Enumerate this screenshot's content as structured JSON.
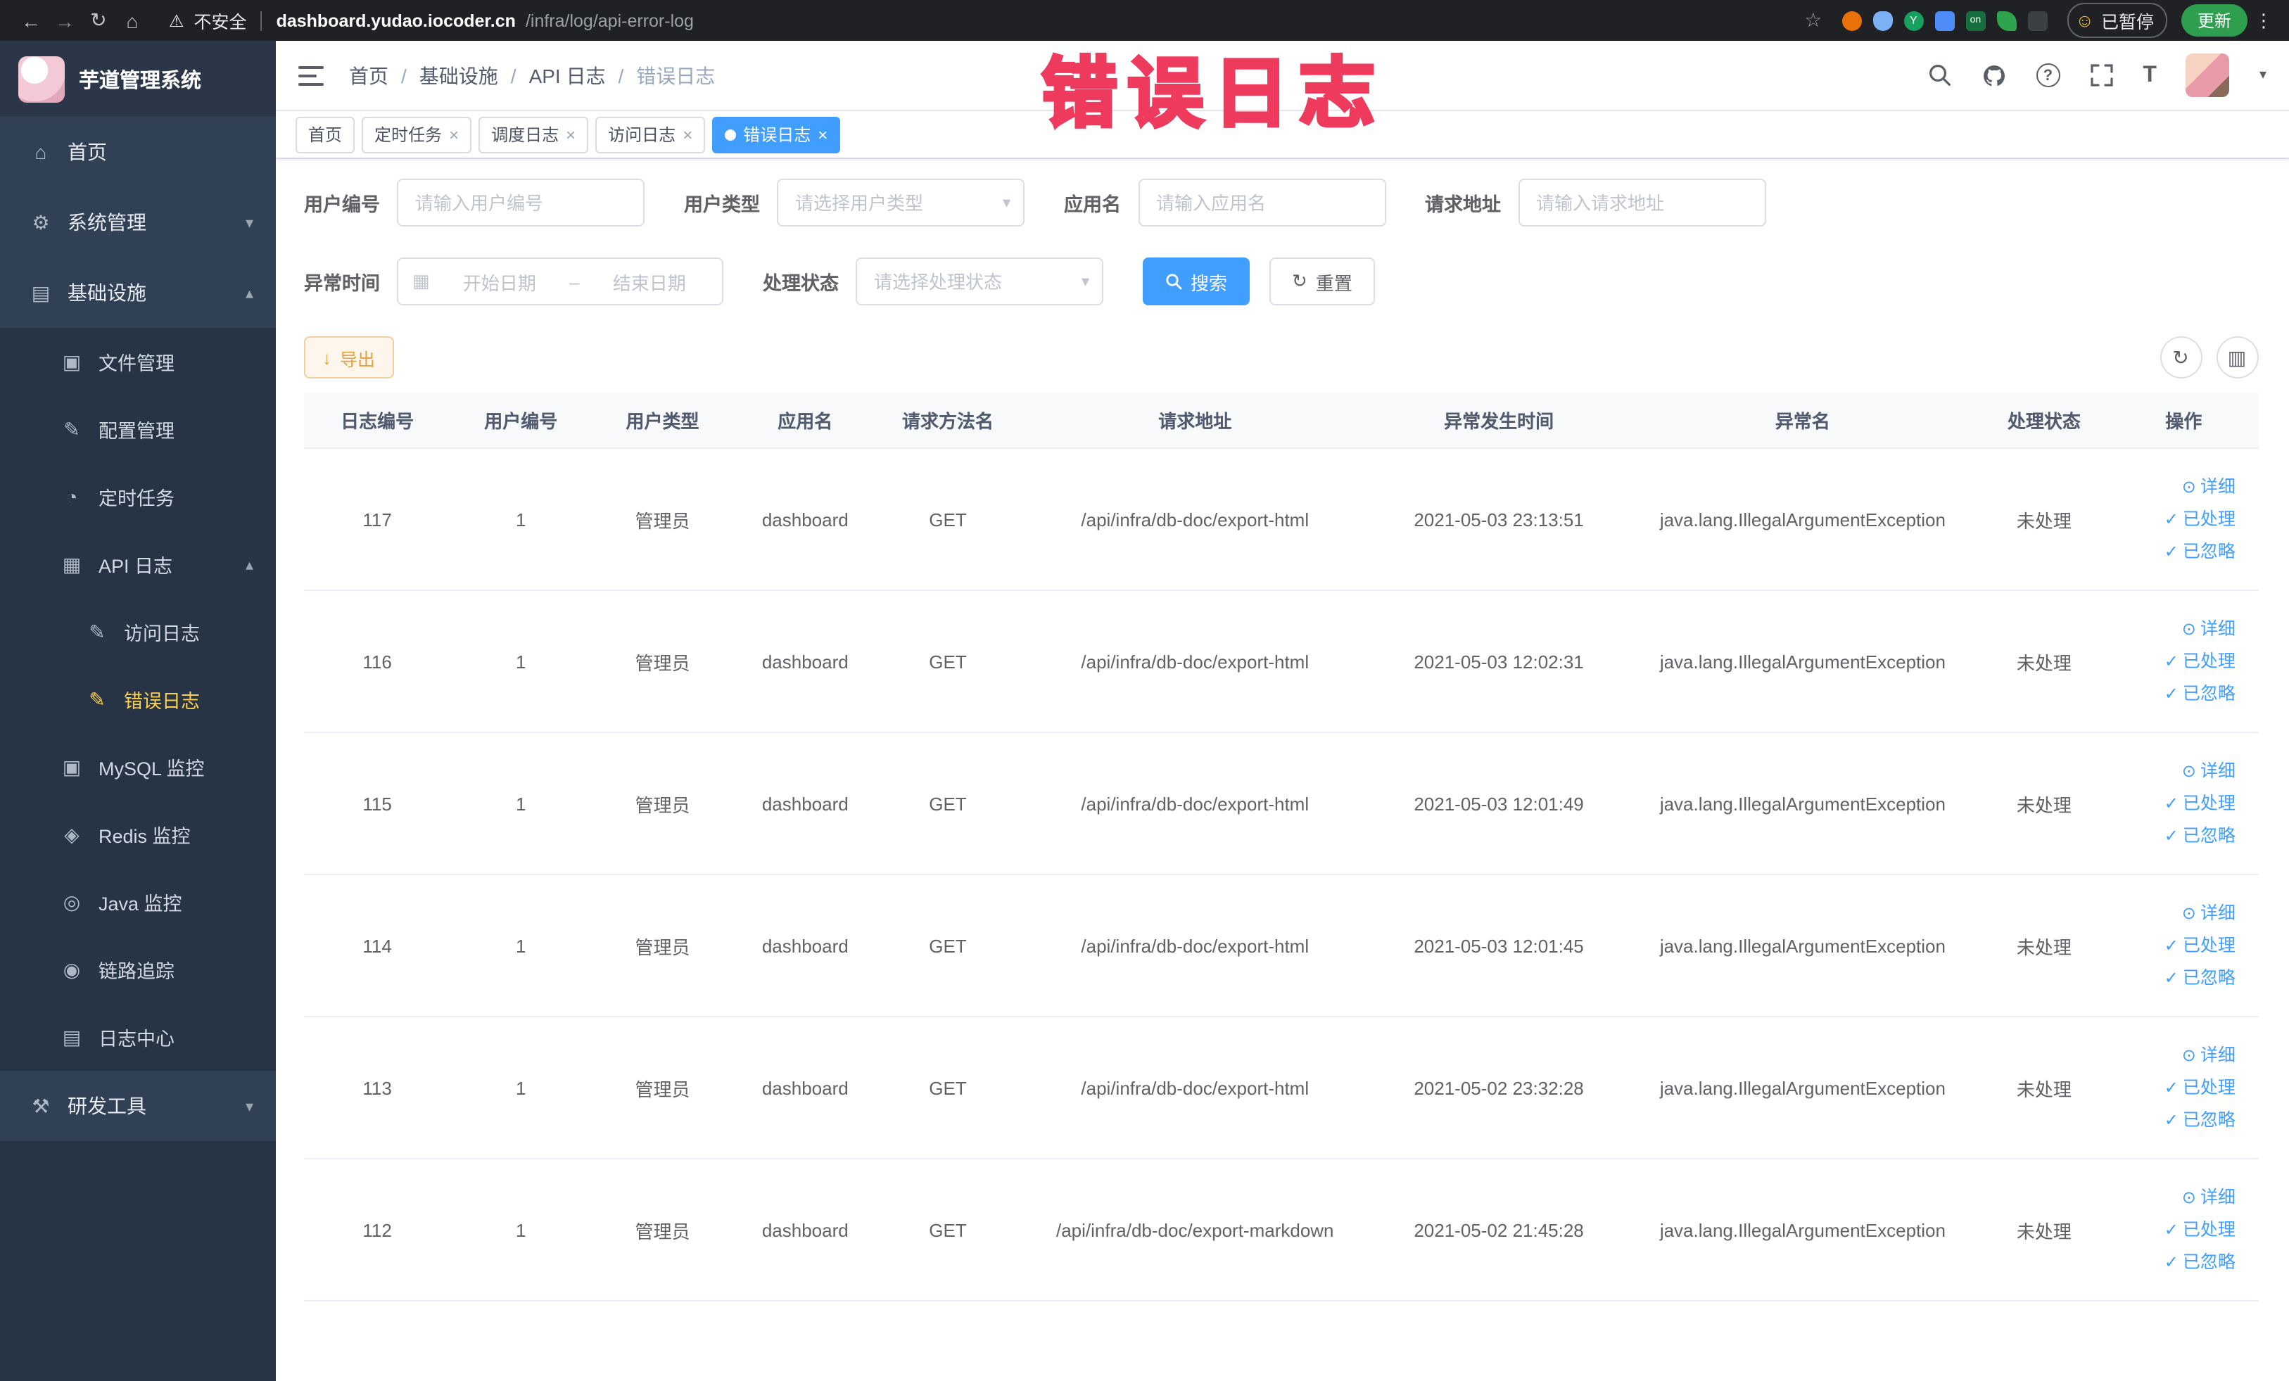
{
  "colors": {
    "primary": "#409eff",
    "sidebar_bg": "#304156",
    "sidebar_sub_bg": "#263445",
    "sidebar_active_text": "#ffd04b",
    "export_btn_bg": "#fdf6ec",
    "export_btn_border": "#f3d19e",
    "export_btn_text": "#e6a23c",
    "watermark": "#fd6e86",
    "browser_bar_bg": "#202124",
    "active_tab_bg": "#409eff"
  },
  "watermark_text": "错误日志",
  "browser": {
    "security_label": "不安全",
    "url_domain": "dashboard.yudao.iocoder.cn",
    "url_path": "/infra/log/api-error-log",
    "paused_label": "已暂停",
    "update_label": "更新"
  },
  "icons": {
    "back": "←",
    "forward": "→",
    "reload": "↻",
    "home": "⌂",
    "warning": "⚠",
    "star": "☆",
    "smiley": "☺",
    "kebab": "⋮",
    "close": "×",
    "caret_down": "▾",
    "caret_up": "▴",
    "check": "✓",
    "eye": "⊙",
    "refresh": "↻",
    "grid": "▥",
    "download": "↓",
    "calendar": "▦",
    "question": "?",
    "fontsize": "T",
    "on_badge": "on",
    "ext_y": "Y"
  },
  "sidebar": {
    "logo_title": "芋道管理系统",
    "items": [
      {
        "label": "首页",
        "icon": "⌂"
      },
      {
        "label": "系统管理",
        "icon": "⚙"
      },
      {
        "label": "基础设施",
        "icon": "▤"
      },
      {
        "label": "文件管理",
        "icon": "▣"
      },
      {
        "label": "配置管理",
        "icon": "✎"
      },
      {
        "label": "定时任务",
        "icon": "◔"
      },
      {
        "label": "API 日志",
        "icon": "▦"
      },
      {
        "label": "访问日志",
        "icon": "✎"
      },
      {
        "label": "错误日志",
        "icon": "✎"
      },
      {
        "label": "MySQL 监控",
        "icon": "▣"
      },
      {
        "label": "Redis 监控",
        "icon": "◈"
      },
      {
        "label": "Java 监控",
        "icon": "◎"
      },
      {
        "label": "链路追踪",
        "icon": "◉"
      },
      {
        "label": "日志中心",
        "icon": "▤"
      },
      {
        "label": "研发工具",
        "icon": "⚒"
      }
    ]
  },
  "breadcrumb": {
    "items": [
      "首页",
      "基础设施",
      "API 日志",
      "错误日志"
    ],
    "separator": "/"
  },
  "tabs": [
    {
      "label": "首页"
    },
    {
      "label": "定时任务"
    },
    {
      "label": "调度日志"
    },
    {
      "label": "访问日志"
    },
    {
      "label": "错误日志"
    }
  ],
  "filters": {
    "user_id_label": "用户编号",
    "user_id_placeholder": "请输入用户编号",
    "user_type_label": "用户类型",
    "user_type_placeholder": "请选择用户类型",
    "app_name_label": "应用名",
    "app_name_placeholder": "请输入应用名",
    "request_url_label": "请求地址",
    "request_url_placeholder": "请输入请求地址",
    "exception_time_label": "异常时间",
    "start_date_placeholder": "开始日期",
    "end_date_placeholder": "结束日期",
    "date_separator": "–",
    "process_status_label": "处理状态",
    "process_status_placeholder": "请选择处理状态",
    "search_button": "搜索",
    "reset_button": "重置"
  },
  "toolbar": {
    "export_button": "导出"
  },
  "table": {
    "headers": [
      "日志编号",
      "用户编号",
      "用户类型",
      "应用名",
      "请求方法名",
      "请求地址",
      "异常发生时间",
      "异常名",
      "处理状态",
      "操作"
    ],
    "rows": [
      {
        "log_id": "117",
        "user_id": "1",
        "user_type": "管理员",
        "app_name": "dashboard",
        "method": "GET",
        "url": "/api/infra/db-doc/export-html",
        "time": "2021-05-03 23:13:51",
        "exception": "java.lang.IllegalArgumentException",
        "status": "未处理",
        "actions": {
          "detail": "详细",
          "processed": "已处理",
          "ignored": "已忽略"
        }
      },
      {
        "log_id": "116",
        "user_id": "1",
        "user_type": "管理员",
        "app_name": "dashboard",
        "method": "GET",
        "url": "/api/infra/db-doc/export-html",
        "time": "2021-05-03 12:02:31",
        "exception": "java.lang.IllegalArgumentException",
        "status": "未处理",
        "actions": {
          "detail": "详细",
          "processed": "已处理",
          "ignored": "已忽略"
        }
      },
      {
        "log_id": "115",
        "user_id": "1",
        "user_type": "管理员",
        "app_name": "dashboard",
        "method": "GET",
        "url": "/api/infra/db-doc/export-html",
        "time": "2021-05-03 12:01:49",
        "exception": "java.lang.IllegalArgumentException",
        "status": "未处理",
        "actions": {
          "detail": "详细",
          "processed": "已处理",
          "ignored": "已忽略"
        }
      },
      {
        "log_id": "114",
        "user_id": "1",
        "user_type": "管理员",
        "app_name": "dashboard",
        "method": "GET",
        "url": "/api/infra/db-doc/export-html",
        "time": "2021-05-03 12:01:45",
        "exception": "java.lang.IllegalArgumentException",
        "status": "未处理",
        "actions": {
          "detail": "详细",
          "processed": "已处理",
          "ignored": "已忽略"
        }
      },
      {
        "log_id": "113",
        "user_id": "1",
        "user_type": "管理员",
        "app_name": "dashboard",
        "method": "GET",
        "url": "/api/infra/db-doc/export-html",
        "time": "2021-05-02 23:32:28",
        "exception": "java.lang.IllegalArgumentException",
        "status": "未处理",
        "actions": {
          "detail": "详细",
          "processed": "已处理",
          "ignored": "已忽略"
        }
      },
      {
        "log_id": "112",
        "user_id": "1",
        "user_type": "管理员",
        "app_name": "dashboard",
        "method": "GET",
        "url": "/api/infra/db-doc/export-markdown",
        "time": "2021-05-02 21:45:28",
        "exception": "java.lang.IllegalArgumentException",
        "status": "未处理",
        "actions": {
          "detail": "详细",
          "processed": "已处理",
          "ignored": "已忽略"
        }
      }
    ]
  }
}
